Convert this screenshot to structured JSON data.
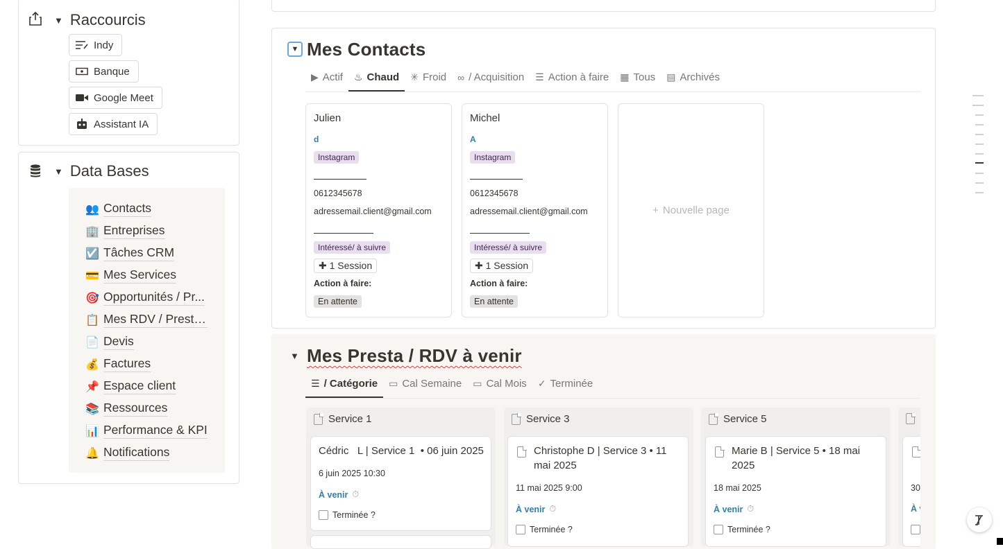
{
  "shortcuts": {
    "title": "Raccourcis",
    "items": [
      {
        "label": "Indy",
        "icon": "notes-icon"
      },
      {
        "label": "Banque",
        "icon": "bank-icon"
      },
      {
        "label": "Google Meet",
        "icon": "video-camera-icon"
      },
      {
        "label": "Assistant IA",
        "icon": "robot-icon"
      }
    ]
  },
  "databases": {
    "title": "Data Bases",
    "items": [
      {
        "emoji": "👥",
        "label": "Contacts"
      },
      {
        "emoji": "🏢",
        "label": "Entreprises"
      },
      {
        "emoji": "☑️",
        "label": "Tâches CRM"
      },
      {
        "emoji": "💳",
        "label": "Mes Services"
      },
      {
        "emoji": "🎯",
        "label": "Opportunités / Pr..."
      },
      {
        "emoji": "📋",
        "label": "Mes RDV / Prestat..."
      },
      {
        "emoji": "📄",
        "label": "Devis"
      },
      {
        "emoji": "💰",
        "label": "Factures"
      },
      {
        "emoji": "📌",
        "label": "Espace client"
      },
      {
        "emoji": "📚",
        "label": "Ressources"
      },
      {
        "emoji": "📊",
        "label": "Performance & KPI"
      },
      {
        "emoji": "🔔",
        "label": "Notifications"
      }
    ]
  },
  "contacts": {
    "title": "Mes Contacts",
    "tabs": [
      {
        "label": "Actif",
        "icon": "play-circle-icon"
      },
      {
        "label": "Chaud",
        "icon": "flame-icon",
        "active": true
      },
      {
        "label": "Froid",
        "icon": "snowflake-icon"
      },
      {
        "label": "/ Acquisition",
        "icon": "glasses-icon"
      },
      {
        "label": "Action à faire",
        "icon": "list-icon"
      },
      {
        "label": "Tous",
        "icon": "grid-icon"
      },
      {
        "label": "Archivés",
        "icon": "archive-icon"
      }
    ],
    "cards": [
      {
        "name": "Julien",
        "letter": "d",
        "source": "Instagram",
        "phone": "0612345678",
        "email": "adressemail.client@gmail.com",
        "status": "Intéressé/ à suivre",
        "session": "1 Session",
        "action_label": "Action à faire:",
        "action_value": "En attente"
      },
      {
        "name": "Michel",
        "letter": "A",
        "source": "Instagram",
        "phone": "0612345678",
        "email": "adressemail.client@gmail.com",
        "status": "Intéressé/ à suivre",
        "session": "1 Session",
        "action_label": "Action à faire:",
        "action_value": "En attente"
      }
    ],
    "new_page": "Nouvelle page"
  },
  "presta": {
    "title": "Mes Presta / RDV à venir",
    "tabs": [
      {
        "label": "/ Catégorie",
        "icon": "list-icon",
        "active": true
      },
      {
        "label": "Cal Semaine",
        "icon": "calendar-icon"
      },
      {
        "label": "Cal Mois",
        "icon": "calendar-icon"
      },
      {
        "label": "Terminée",
        "icon": "check-icon"
      }
    ],
    "columns": [
      {
        "title": "Service 1",
        "card": {
          "title": "Cédric   L | Service 1  • 06 juin 2025",
          "date": "6 juin 2025 10:30",
          "status": "À venir",
          "done": "Terminée ?"
        }
      },
      {
        "title": "Service 3",
        "card": {
          "title": "Christophe D | Service 3 • 11 mai 2025",
          "date": "11 mai 2025 9:00",
          "status": "À venir",
          "done": "Terminée ?"
        }
      },
      {
        "title": "Service 5",
        "card": {
          "title": "Marie  B | Service 5 • 18 mai 2025",
          "date": "18 mai 2025",
          "status": "À venir",
          "done": "Terminée ?"
        }
      },
      {
        "title": "",
        "card": {
          "title": "",
          "date": "30",
          "status": "À v",
          "done": ""
        }
      }
    ]
  },
  "colors": {
    "accent_blue": "#337ea9",
    "tag_purple": "#e8deee",
    "tag_gray": "#e3e2e0"
  }
}
